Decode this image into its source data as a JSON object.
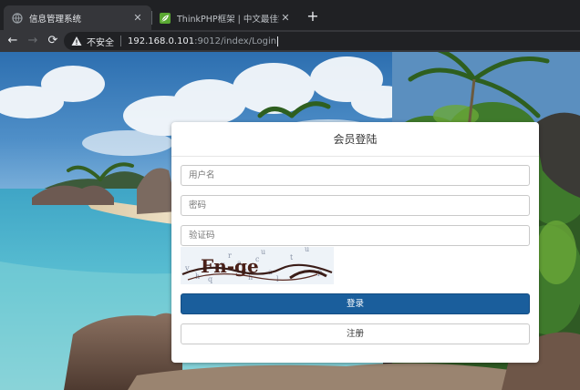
{
  "browser": {
    "tabs": [
      {
        "title": "信息管理系统",
        "active": true,
        "favicon": "globe-icon"
      },
      {
        "title": "ThinkPHP框架 | 中文最佳实践PH",
        "active": false,
        "favicon": "thinkphp-leaf-icon"
      }
    ],
    "close_glyph": "✕",
    "new_tab_glyph": "+",
    "nav": {
      "back": "←",
      "forward": "→",
      "reload": "⟳"
    },
    "address": {
      "security_label": "不安全",
      "url_host": "192.168.0.101",
      "url_rest": ":9012/index/Login"
    }
  },
  "login": {
    "title": "会员登陆",
    "username_placeholder": "用户名",
    "password_placeholder": "密码",
    "captcha_placeholder": "验证码",
    "captcha_text": "Fn-ge",
    "login_button": "登录",
    "register_button": "注册"
  },
  "colors": {
    "primary_button": "#1a5e9c",
    "chrome_dark": "#202124",
    "chrome_mid": "#35363a"
  }
}
